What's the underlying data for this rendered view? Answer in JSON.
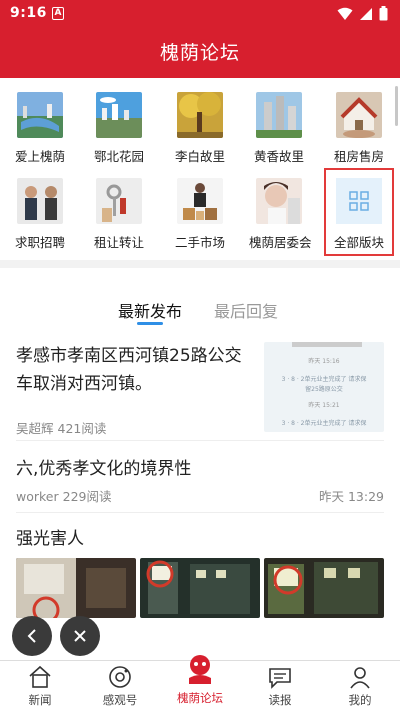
{
  "status_bar": {
    "time": "9:16",
    "notif_glyph": "A"
  },
  "header": {
    "title": "槐荫论坛"
  },
  "grid": {
    "row1": [
      {
        "label": "爱上槐荫",
        "icon": "city-photo"
      },
      {
        "label": "鄂北花园",
        "icon": "city-photo"
      },
      {
        "label": "李白故里",
        "icon": "tree-photo"
      },
      {
        "label": "黄香故里",
        "icon": "tower-photo"
      },
      {
        "label": "租房售房",
        "icon": "house-photo"
      }
    ],
    "row2": [
      {
        "label": "求职招聘",
        "icon": "interview-photo"
      },
      {
        "label": "租让转让",
        "icon": "keys-photo"
      },
      {
        "label": "二手市场",
        "icon": "market-photo"
      },
      {
        "label": "槐荫居委会",
        "icon": "person-photo"
      },
      {
        "label": "全部版块",
        "icon": "grid-icon"
      }
    ]
  },
  "tabs": {
    "latest": "最新发布",
    "reply": "最后回复"
  },
  "posts": [
    {
      "title": "孝感市孝南区西河镇25路公交车取消对西河镇。",
      "author": "吴超辉",
      "reads": "421阅读",
      "thumb_lines": [
        "昨天 15:16",
        "3 · 8 · 2单元业主完成了 请求保",
        "留25路原公交",
        "昨天 15:21",
        "3 · 8 · 2单元业主完成了 请求保"
      ]
    },
    {
      "title": "六,优秀孝文化的境界性",
      "author": "worker",
      "reads": "229阅读",
      "time": "昨天 13:29"
    },
    {
      "title": "强光害人"
    }
  ],
  "bottom_nav": [
    {
      "label": "新闻",
      "icon": "house-icon"
    },
    {
      "label": "感观号",
      "icon": "camera-icon"
    },
    {
      "label": "槐荫论坛",
      "icon": "forum-icon"
    },
    {
      "label": "读报",
      "icon": "chat-icon"
    },
    {
      "label": "我的",
      "icon": "user-icon"
    }
  ],
  "colors": {
    "brand": "#d71f2e",
    "accent": "#2f8fe6",
    "highlight": "#e23a3a"
  }
}
